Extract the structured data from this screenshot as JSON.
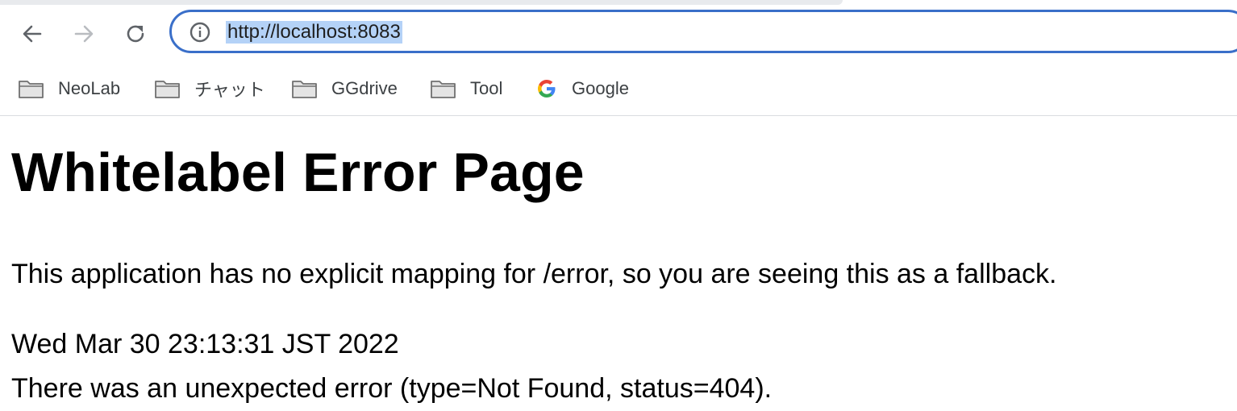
{
  "browser": {
    "url": "http://localhost:8083",
    "bookmarks": [
      {
        "label": "NeoLab",
        "icon": "folder-icon"
      },
      {
        "label": "チャット",
        "icon": "folder-icon"
      },
      {
        "label": "GGdrive",
        "icon": "folder-icon"
      },
      {
        "label": "Tool",
        "icon": "folder-icon"
      },
      {
        "label": "Google",
        "icon": "google-icon"
      }
    ],
    "colors": {
      "omnibox_border": "#3a6fc9",
      "url_selection": "#b4d2f7"
    }
  },
  "page": {
    "title": "Whitelabel Error Page",
    "message": "This application has no explicit mapping for /error, so you are seeing this as a fallback.",
    "timestamp": "Wed Mar 30 23:13:31 JST 2022",
    "error": "There was an unexpected error (type=Not Found, status=404)."
  }
}
